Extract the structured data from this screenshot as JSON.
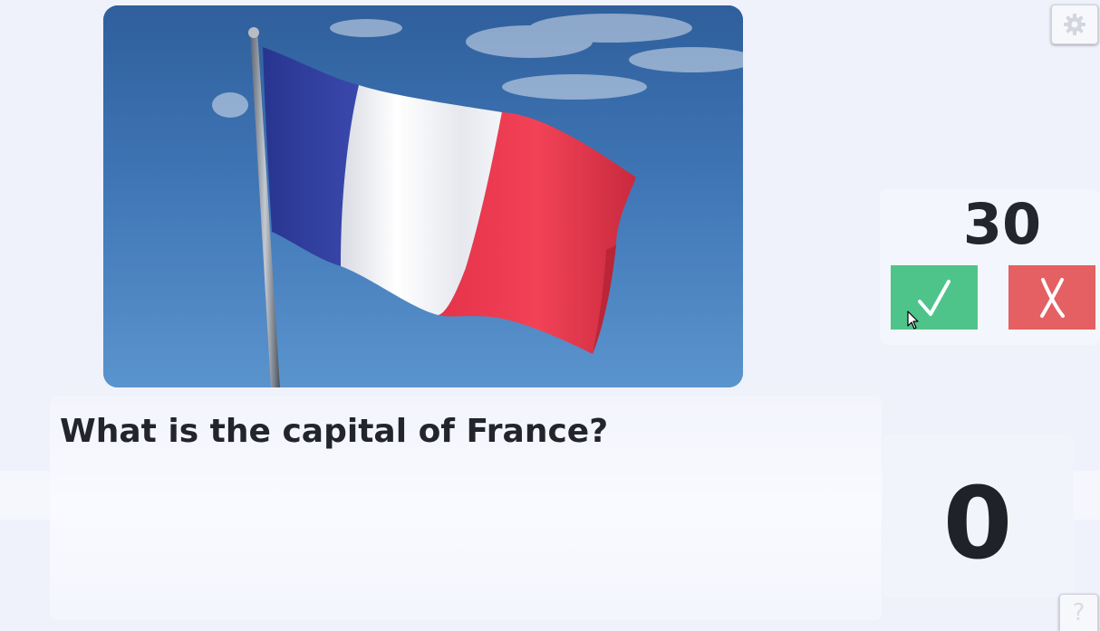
{
  "question": {
    "text": "What is the capital of France?"
  },
  "image": {
    "subject": "flag of France"
  },
  "timer": {
    "value": "30"
  },
  "answer_buttons": {
    "correct_icon": "check-icon",
    "wrong_icon": "x-icon"
  },
  "score": {
    "value": "0"
  },
  "settings": {
    "icon": "gear-icon"
  },
  "help": {
    "label": "?"
  },
  "colors": {
    "correct": "#4ec48a",
    "wrong": "#e46062",
    "background": "#eff2fb",
    "panel": "#f4f6fd",
    "text": "#1f2329"
  }
}
